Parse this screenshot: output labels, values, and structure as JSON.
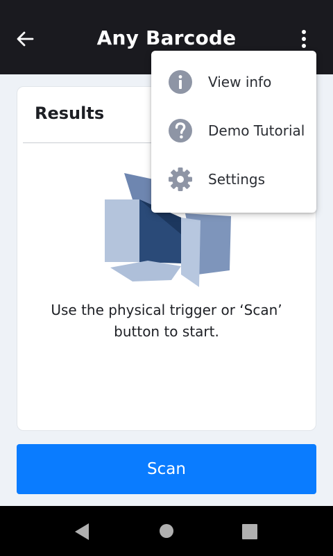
{
  "appbar": {
    "title": "Any Barcode",
    "back_icon": "arrow-left-icon",
    "more_icon": "more-vertical-icon"
  },
  "card": {
    "title": "Results",
    "illustration": "scan-placeholder-illustration",
    "instructions": "Use the physical trigger or ‘Scan’ button to start."
  },
  "scan_button": {
    "label": "Scan",
    "color": "#0a7cff"
  },
  "menu": {
    "items": [
      {
        "label": "View info",
        "icon": "info-icon"
      },
      {
        "label": "Demo Tutorial",
        "icon": "help-icon"
      },
      {
        "label": "Settings",
        "icon": "gear-icon"
      }
    ]
  },
  "navbar": {
    "items": [
      "back-triangle-icon",
      "home-circle-icon",
      "recents-square-icon"
    ]
  },
  "colors": {
    "appbar_bg": "#1a1a1f",
    "background": "#eef2f7",
    "menu_icon": "#8e95a5"
  }
}
